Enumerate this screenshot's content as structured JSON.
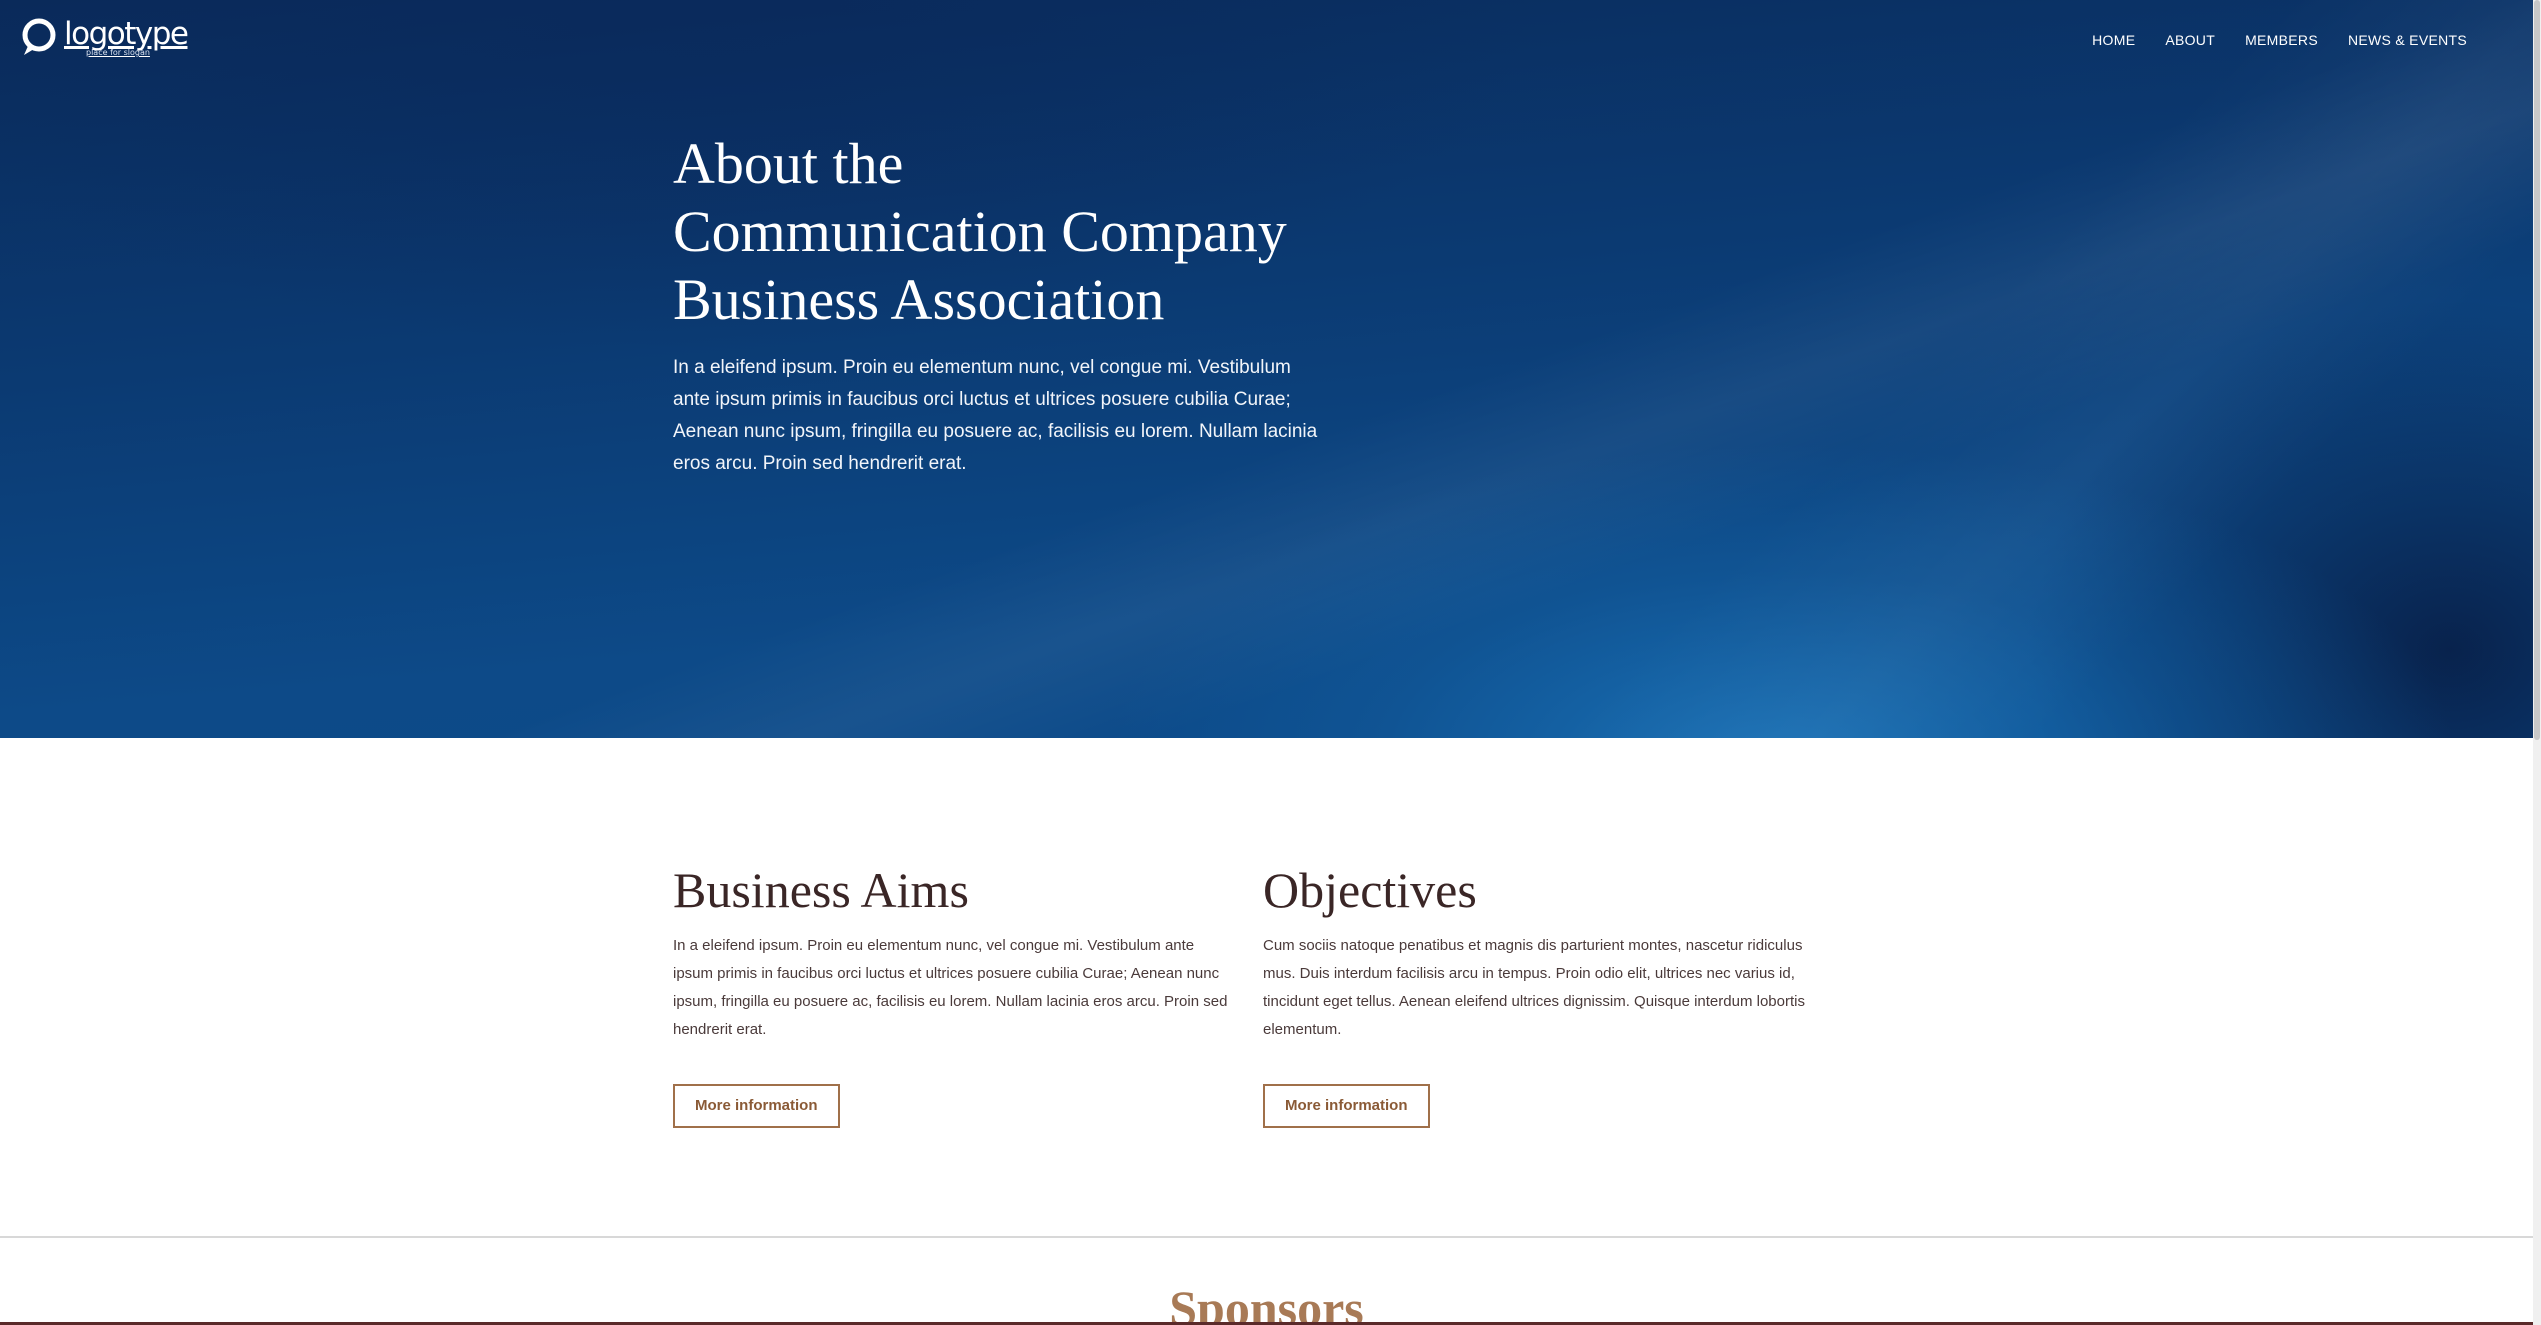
{
  "colors": {
    "hero_bg": "#0b3a72",
    "accent": "#a0704a",
    "heading_dark": "#3a2626",
    "sponsors": "#a87a56"
  },
  "logo": {
    "icon": "logo-mark-icon",
    "text": "logotype",
    "slogan": "place for slogan"
  },
  "nav": {
    "items": [
      {
        "label": "HOME"
      },
      {
        "label": "ABOUT"
      },
      {
        "label": "MEMBERS"
      },
      {
        "label": "NEWS & EVENTS"
      }
    ]
  },
  "hero": {
    "title_lines": [
      "About the",
      "Communication Company",
      "Business Association"
    ],
    "body": "In a eleifend ipsum. Proin eu elementum nunc, vel congue mi. Vestibulum ante ipsum primis in faucibus orci luctus et ultrices posuere cubilia Curae; Aenean nunc ipsum, fringilla eu posuere ac, facilisis eu lorem. Nullam lacinia eros arcu. Proin sed hendrerit erat."
  },
  "aims": {
    "title": "Business Aims",
    "body": "In a eleifend ipsum. Proin eu elementum nunc, vel congue mi. Vestibulum ante ipsum primis in faucibus orci luctus et ultrices posuere cubilia Curae; Aenean nunc ipsum, fringilla eu posuere ac, facilisis eu lorem. Nullam lacinia eros arcu. Proin sed hendrerit erat.",
    "button": "More information"
  },
  "objectives": {
    "title": "Objectives",
    "body": "Cum sociis natoque penatibus et magnis dis parturient montes, nascetur ridiculus mus. Duis interdum facilisis arcu in tempus. Proin odio elit, ultrices nec varius id, tincidunt eget tellus. Aenean eleifend ultrices dignissim. Quisque interdum lobortis elementum.",
    "button": "More information"
  },
  "sponsors": {
    "title": "Sponsors"
  }
}
